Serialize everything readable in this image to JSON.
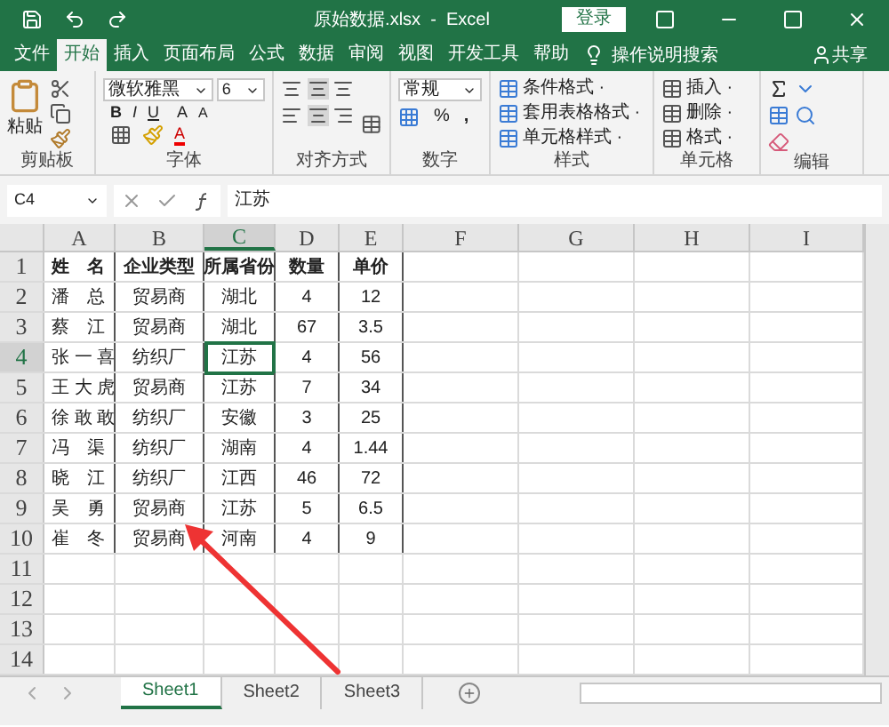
{
  "window": {
    "title": "原始数据.xlsx  -  Excel",
    "sign_in": "登录"
  },
  "tabs": [
    {
      "label": "文件",
      "selected": false
    },
    {
      "label": "开始",
      "selected": true
    },
    {
      "label": "插入",
      "selected": false
    },
    {
      "label": "页面布局",
      "selected": false
    },
    {
      "label": "公式",
      "selected": false
    },
    {
      "label": "数据",
      "selected": false
    },
    {
      "label": "审阅",
      "selected": false
    },
    {
      "label": "视图",
      "selected": false
    },
    {
      "label": "开发工具",
      "selected": false
    },
    {
      "label": "帮助",
      "selected": false
    }
  ],
  "tell_me": "操作说明搜索",
  "share": "共享",
  "ribbon": {
    "clipboard": {
      "label": "剪贴板",
      "paste": "粘贴"
    },
    "font": {
      "label": "字体",
      "font_name": "微软雅黑",
      "font_size": "6",
      "styles": [
        "B",
        "I",
        "U"
      ],
      "grow": "A",
      "shrink": "A",
      "font_color": "A"
    },
    "alignment": {
      "label": "对齐方式"
    },
    "number": {
      "label": "数字",
      "format": "常规",
      "percent": "%",
      "comma": ","
    },
    "styles": {
      "label": "样式",
      "items": [
        "条件格式 ·",
        "套用表格格式 ·",
        "单元格样式 ·"
      ]
    },
    "cells": {
      "label": "单元格",
      "items": [
        "插入 ·",
        "删除 ·",
        "格式 ·"
      ]
    },
    "editing": {
      "label": "编辑"
    }
  },
  "formula_bar": {
    "name_box": "C4",
    "value": "江苏"
  },
  "sheet": {
    "columns": [
      {
        "label": "A",
        "selected": false
      },
      {
        "label": "B",
        "selected": false
      },
      {
        "label": "C",
        "selected": true
      },
      {
        "label": "D",
        "selected": false
      },
      {
        "label": "E",
        "selected": false
      },
      {
        "label": "F",
        "selected": false
      },
      {
        "label": "G",
        "selected": false
      },
      {
        "label": "H",
        "selected": false
      },
      {
        "label": "I",
        "selected": false
      }
    ],
    "rows": [
      {
        "header": "1",
        "selected": false,
        "cells": [
          {
            "text": "姓　名",
            "selected": false
          },
          {
            "text": "企业类型",
            "selected": false
          },
          {
            "text": "所属省份",
            "selected": false
          },
          {
            "text": "数量",
            "selected": false
          },
          {
            "text": "单价",
            "selected": false
          }
        ]
      },
      {
        "header": "2",
        "selected": false,
        "cells": [
          {
            "text": "潘　总",
            "selected": false
          },
          {
            "text": "贸易商",
            "selected": false
          },
          {
            "text": "湖北",
            "selected": false
          },
          {
            "text": "4",
            "selected": false
          },
          {
            "text": "12",
            "selected": false
          }
        ]
      },
      {
        "header": "3",
        "selected": false,
        "cells": [
          {
            "text": "蔡　江",
            "selected": false
          },
          {
            "text": "贸易商",
            "selected": false
          },
          {
            "text": "湖北",
            "selected": false
          },
          {
            "text": "67",
            "selected": false
          },
          {
            "text": "3.5",
            "selected": false
          }
        ]
      },
      {
        "header": "4",
        "selected": true,
        "cells": [
          {
            "text": "张 一 喜",
            "selected": false
          },
          {
            "text": "纺织厂",
            "selected": false
          },
          {
            "text": "江苏",
            "selected": true
          },
          {
            "text": "4",
            "selected": false
          },
          {
            "text": "56",
            "selected": false
          }
        ]
      },
      {
        "header": "5",
        "selected": false,
        "cells": [
          {
            "text": "王 大 虎",
            "selected": false
          },
          {
            "text": "贸易商",
            "selected": false
          },
          {
            "text": "江苏",
            "selected": false
          },
          {
            "text": "7",
            "selected": false
          },
          {
            "text": "34",
            "selected": false
          }
        ]
      },
      {
        "header": "6",
        "selected": false,
        "cells": [
          {
            "text": "徐 敢 敢",
            "selected": false
          },
          {
            "text": "纺织厂",
            "selected": false
          },
          {
            "text": "安徽",
            "selected": false
          },
          {
            "text": "3",
            "selected": false
          },
          {
            "text": "25",
            "selected": false
          }
        ]
      },
      {
        "header": "7",
        "selected": false,
        "cells": [
          {
            "text": "冯　渠",
            "selected": false
          },
          {
            "text": "纺织厂",
            "selected": false
          },
          {
            "text": "湖南",
            "selected": false
          },
          {
            "text": "4",
            "selected": false
          },
          {
            "text": "1.44",
            "selected": false
          }
        ]
      },
      {
        "header": "8",
        "selected": false,
        "cells": [
          {
            "text": "晓　江",
            "selected": false
          },
          {
            "text": "纺织厂",
            "selected": false
          },
          {
            "text": "江西",
            "selected": false
          },
          {
            "text": "46",
            "selected": false
          },
          {
            "text": "72",
            "selected": false
          }
        ]
      },
      {
        "header": "9",
        "selected": false,
        "cells": [
          {
            "text": "吴　勇",
            "selected": false
          },
          {
            "text": "贸易商",
            "selected": false
          },
          {
            "text": "江苏",
            "selected": false
          },
          {
            "text": "5",
            "selected": false
          },
          {
            "text": "6.5",
            "selected": false
          }
        ]
      },
      {
        "header": "10",
        "selected": false,
        "cells": [
          {
            "text": "崔　冬",
            "selected": false
          },
          {
            "text": "贸易商",
            "selected": false
          },
          {
            "text": "河南",
            "selected": false
          },
          {
            "text": "4",
            "selected": false
          },
          {
            "text": "9",
            "selected": false
          }
        ]
      }
    ],
    "empty_rows": [
      "11",
      "12",
      "13",
      "14"
    ]
  },
  "sheet_tabs": [
    {
      "label": "Sheet1",
      "selected": true
    },
    {
      "label": "Sheet2",
      "selected": false
    },
    {
      "label": "Sheet3",
      "selected": false
    }
  ]
}
